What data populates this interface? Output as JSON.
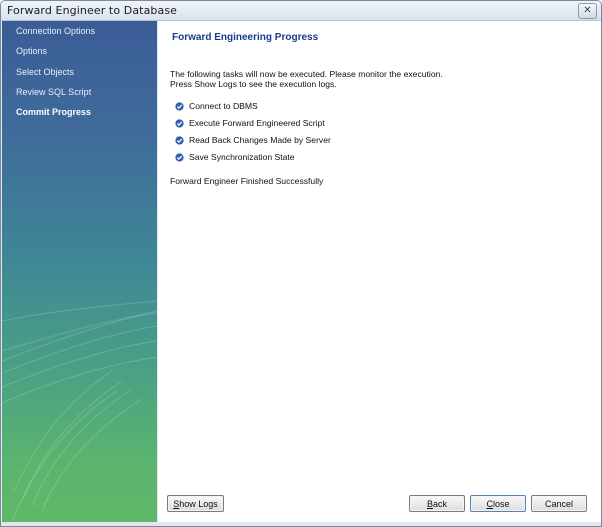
{
  "window": {
    "title": "Forward Engineer to Database",
    "close_glyph": "✕"
  },
  "sidebar": {
    "items": [
      {
        "label": "Connection Options",
        "active": false
      },
      {
        "label": "Options",
        "active": false
      },
      {
        "label": "Select Objects",
        "active": false
      },
      {
        "label": "Review SQL Script",
        "active": false
      },
      {
        "label": "Commit Progress",
        "active": true
      }
    ]
  },
  "main": {
    "heading": "Forward Engineering Progress",
    "description_line1": "The following tasks will now be executed. Please monitor the execution.",
    "description_line2": "Press Show Logs to see the execution logs.",
    "tasks": [
      {
        "label": "Connect to DBMS",
        "done": true
      },
      {
        "label": "Execute Forward Engineered Script",
        "done": true
      },
      {
        "label": "Read Back Changes Made by Server",
        "done": true
      },
      {
        "label": "Save Synchronization State",
        "done": true
      }
    ],
    "status": "Forward Engineer Finished Successfully"
  },
  "buttons": {
    "show_logs_mnemonic": "S",
    "show_logs_rest": "how Logs",
    "back_mnemonic": "B",
    "back_rest": "ack",
    "close_mnemonic": "C",
    "close_rest": "lose",
    "cancel": "Cancel"
  },
  "colors": {
    "heading": "#1a3b8c",
    "check": "#2f5fae",
    "sidebar_top": "#3b5c98",
    "sidebar_bottom": "#5fb868"
  }
}
